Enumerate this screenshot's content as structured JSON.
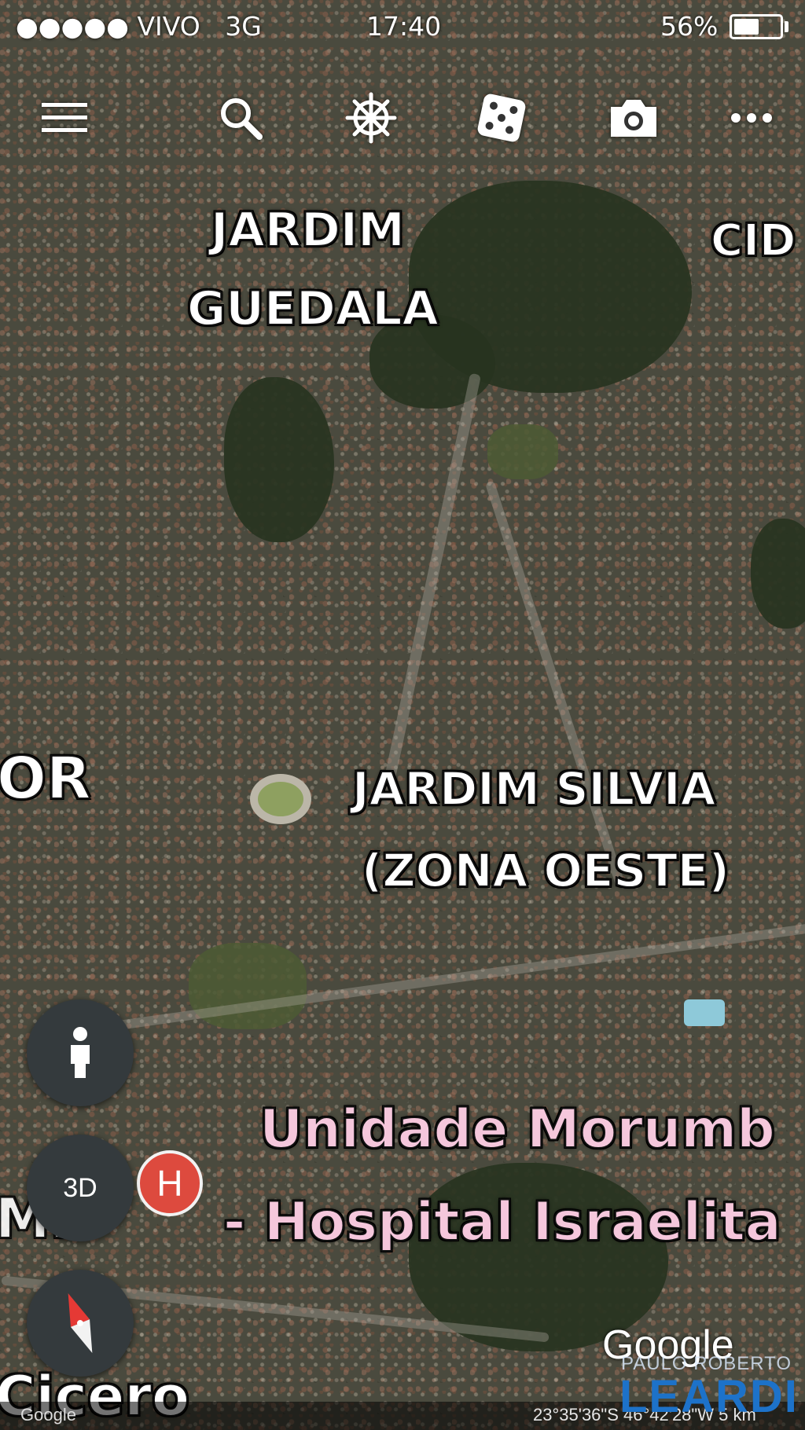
{
  "status_bar": {
    "signal_carrier": "●●●●● VIVO",
    "network": "3G",
    "time": "17:40",
    "battery_text": "56%",
    "battery_level": 0.56
  },
  "toolbar": {
    "icons": [
      "menu-icon",
      "search-icon",
      "voyager-wheel-icon",
      "dice-icon",
      "camera-icon",
      "more-icon"
    ]
  },
  "map_labels": {
    "jardim_guedala_1": "JARDIM",
    "jardim_guedala_2": "GUEDALA",
    "cidade_partial": "CID",
    "or_partial": "OR",
    "jardim_silvia_1": "JARDIM SILVIA",
    "jardim_silvia_2": "(ZONA OESTE)",
    "hospital_1": "Unidade Morumb",
    "hospital_2": "- Hospital Israelita",
    "left_partial": "MB",
    "cicero_partial": "Cicero"
  },
  "controls": {
    "pegman_icon": "person-icon",
    "view_3d_label": "3D",
    "compass_icon": "compass-icon",
    "hospital_marker": "H"
  },
  "footer": {
    "google_small": "Google",
    "coordinates": "23°35'36\"S 46°42'28\"W  5 km",
    "google_logo": "Google"
  },
  "watermark": {
    "top": "PAULO ROBERTO",
    "main": "LEARDI"
  },
  "colors": {
    "accent_pink": "#f5c7dc",
    "hospital_red": "#dd4a3e",
    "fab_dark": "#343a3d",
    "watermark_blue": "#1d72c9"
  }
}
